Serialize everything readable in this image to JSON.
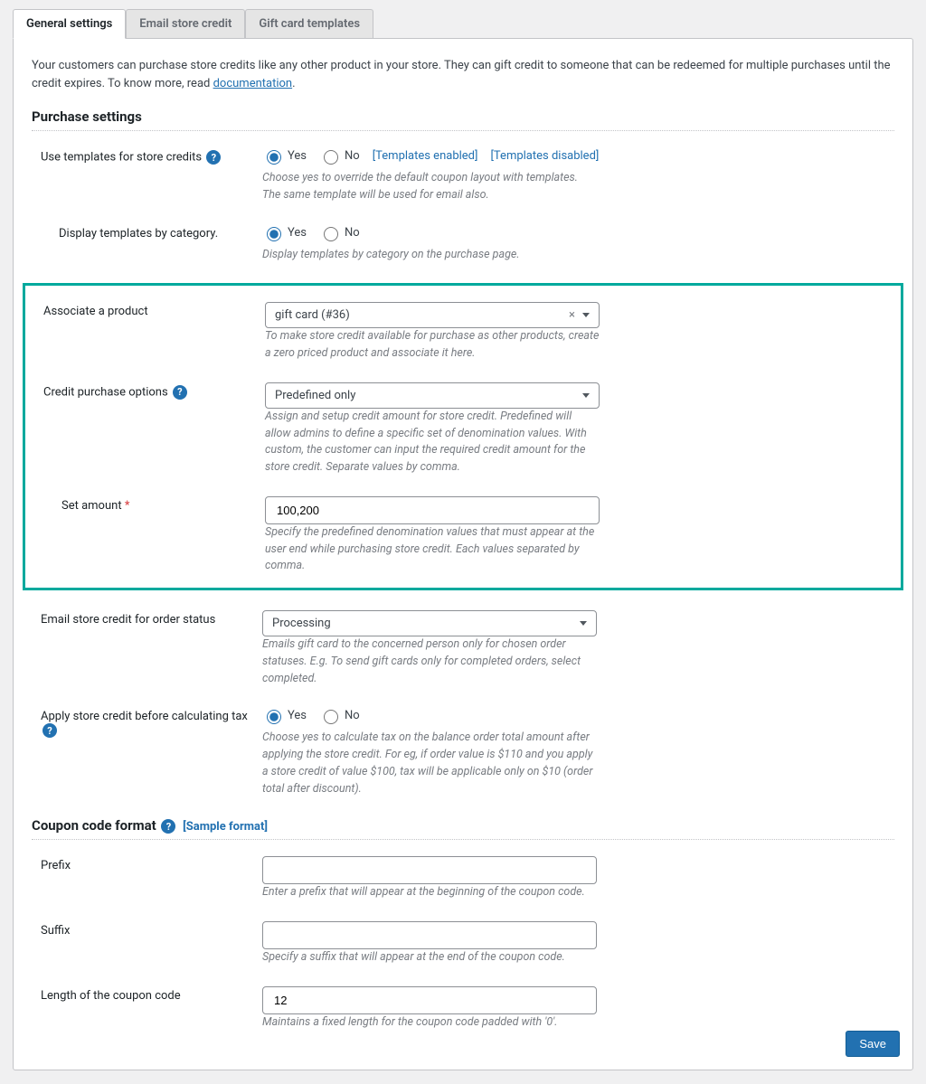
{
  "tabs": {
    "general": "General settings",
    "email": "Email store credit",
    "gift": "Gift card templates"
  },
  "intro": {
    "text1": "Your customers can purchase store credits like any other product in your store. They can gift credit to someone that can be redeemed for multiple purchases until the credit expires. To know more, read ",
    "doclink": "documentation",
    "text2": "."
  },
  "sections": {
    "purchase": "Purchase settings",
    "coupon": "Coupon code format",
    "sample_format": "[Sample format]"
  },
  "radio_yes": "Yes",
  "radio_no": "No",
  "fields": {
    "use_templates": {
      "label": "Use templates for store credits",
      "link_enabled": "[Templates enabled]",
      "link_disabled": "[Templates disabled]",
      "desc": "Choose yes to override the default coupon layout with templates. The same template will be used for email also."
    },
    "display_by_cat": {
      "label": "Display templates by category.",
      "desc": "Display templates by category on the purchase page."
    },
    "associate": {
      "label": "Associate a product",
      "value": "gift card (#36)",
      "desc": "To make store credit available for purchase as other products, create a zero priced product and associate it here."
    },
    "credit_options": {
      "label": "Credit purchase options",
      "value": "Predefined only",
      "desc": "Assign and setup credit amount for store credit. Predefined will allow admins to define a specific set of denomination values. With custom, the customer can input the required credit amount for the store credit. Separate values by comma."
    },
    "set_amount": {
      "label": "Set amount",
      "required": "*",
      "value": "100,200",
      "desc": "Specify the predefined denomination values that must appear at the user end while purchasing store credit. Each values separated by comma."
    },
    "email_status": {
      "label": "Email store credit for order status",
      "value": "Processing",
      "desc": "Emails gift card to the concerned person only for chosen order statuses. E.g. To send gift cards only for completed orders, select completed."
    },
    "apply_before_tax": {
      "label": "Apply store credit before calculating tax",
      "desc": "Choose yes to calculate tax on the balance order total amount after applying the store credit. For eg, if order value is $110 and you apply a store credit of value $100, tax will be applicable only on $10 (order total after discount)."
    },
    "prefix": {
      "label": "Prefix",
      "value": "",
      "desc": "Enter a prefix that will appear at the beginning of the coupon code."
    },
    "suffix": {
      "label": "Suffix",
      "value": "",
      "desc": "Specify a suffix that will appear at the end of the coupon code."
    },
    "length": {
      "label": "Length of the coupon code",
      "value": "12",
      "desc": "Maintains a fixed length for the coupon code padded with '0'."
    }
  },
  "save_label": "Save"
}
